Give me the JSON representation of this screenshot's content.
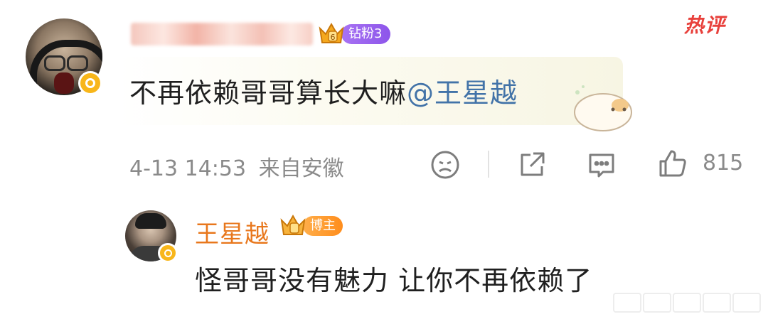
{
  "comment": {
    "fan_badge": {
      "level_text": "钻粉3",
      "color": "#9b63ef"
    },
    "hot_label": "热评",
    "text_main": "不再依赖哥哥算长大嘛",
    "mention": "@王星越",
    "timestamp": "4-13 14:53",
    "location": "来自安徽",
    "like_count": "815",
    "actions": [
      "dislike-icon",
      "share-icon",
      "comment-icon",
      "like-icon"
    ]
  },
  "reply": {
    "author": "王星越",
    "badge_text": "博主",
    "badge_color": "#ff9628",
    "text": "怪哥哥没有魅力 让你不再依赖了"
  },
  "colors": {
    "mention": "#4273a8",
    "hot": "#e8413c",
    "author": "#e8771c",
    "meta": "#8a8a8a"
  }
}
